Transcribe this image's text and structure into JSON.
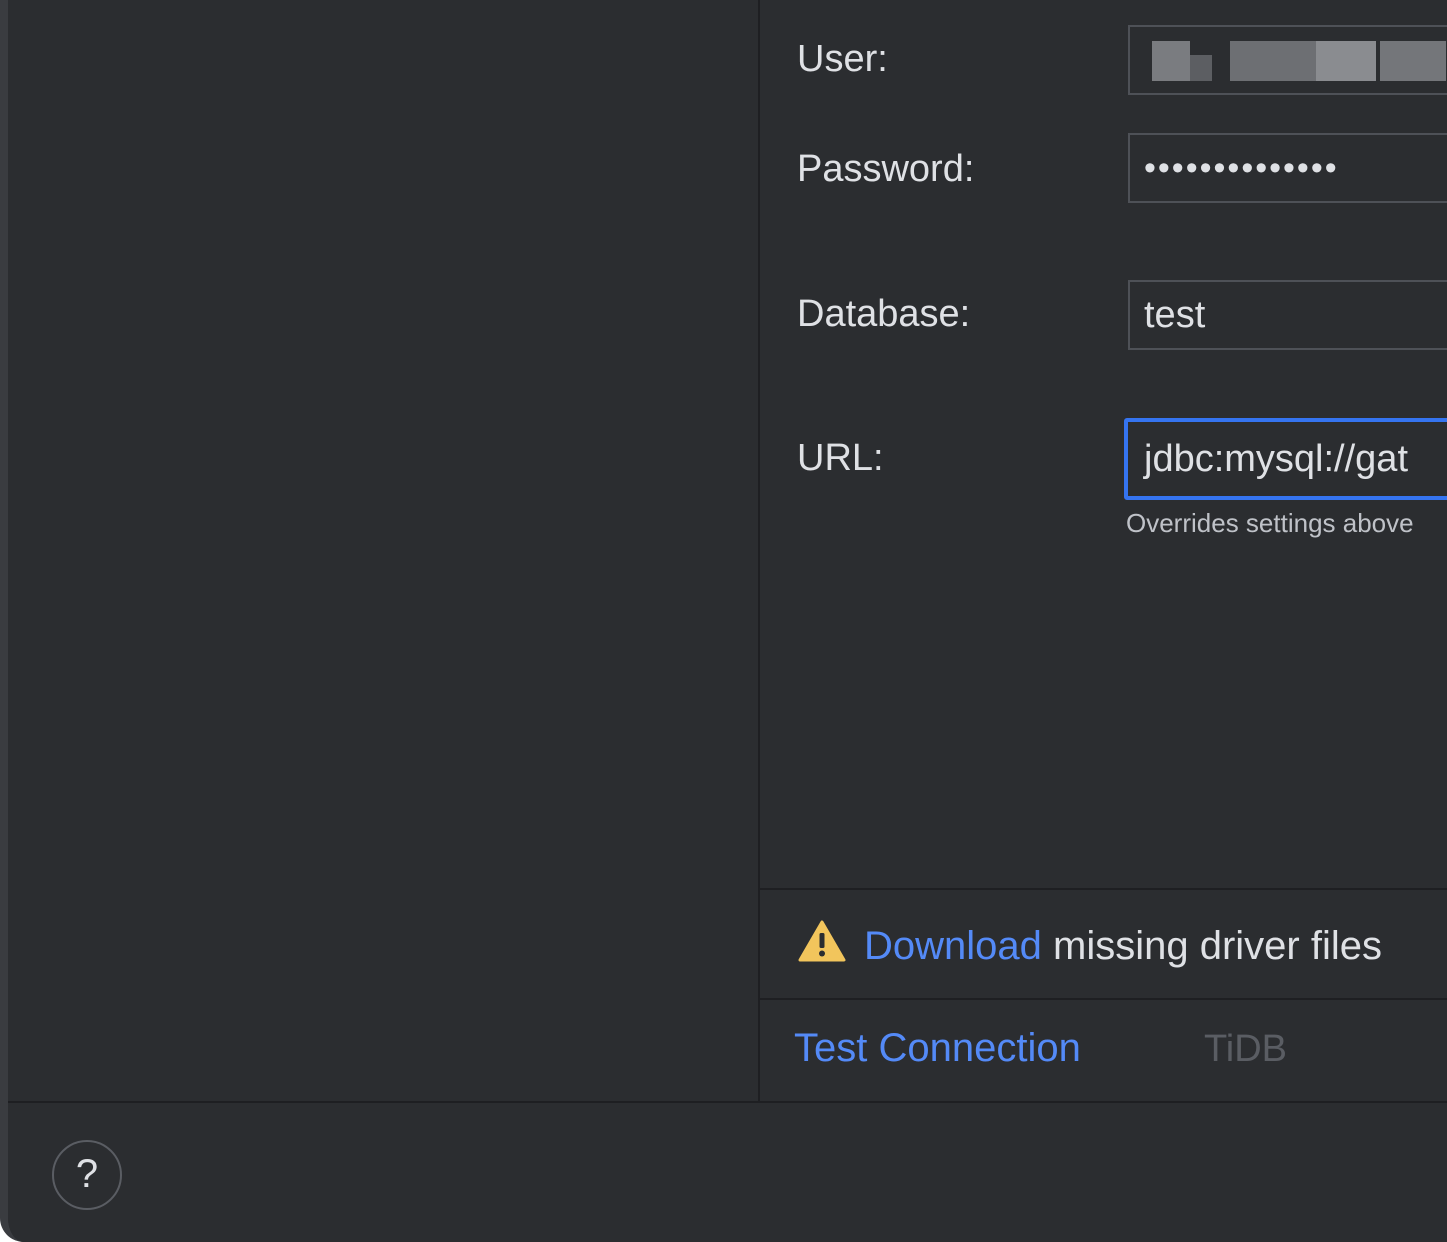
{
  "form": {
    "user": {
      "label": "User:",
      "value_visibility": "obscured"
    },
    "password": {
      "label": "Password:",
      "masked_value": "••••••••••••••"
    },
    "database": {
      "label": "Database:",
      "value": "test"
    },
    "url": {
      "label": "URL:",
      "value": "jdbc:mysql://gat",
      "hint": "Overrides settings above"
    }
  },
  "warning": {
    "icon": "warning-icon",
    "link_text": "Download",
    "text": " missing driver files"
  },
  "actions": {
    "test_connection_label": "Test Connection",
    "driver_label": "TiDB"
  },
  "footer": {
    "help_label": "?",
    "help_icon": "question-circle-icon"
  },
  "colors": {
    "background": "#2b2d30",
    "link": "#548af7",
    "focus_border": "#3574f0",
    "warning": "#f2c55c"
  }
}
